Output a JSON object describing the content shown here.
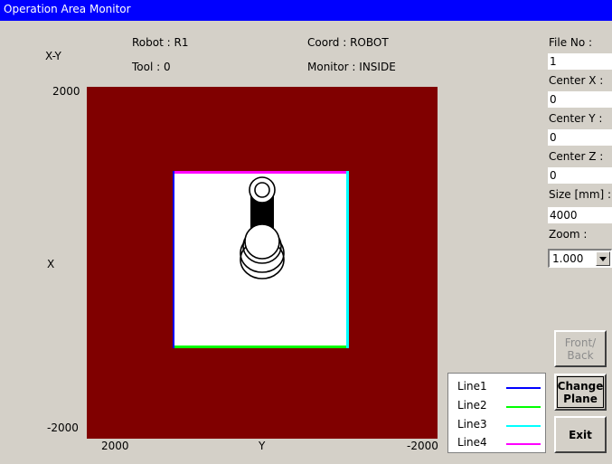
{
  "window": {
    "title": "Operation Area Monitor"
  },
  "header": {
    "plane_label": "X-Y",
    "robot": "Robot : R1",
    "tool": "Tool : 0",
    "coord": "Coord : ROBOT",
    "monitor": "Monitor : INSIDE"
  },
  "plot": {
    "y_max_label": "2000",
    "y_min_label": "-2000",
    "x_left_label": "2000",
    "x_right_label": "-2000",
    "vertical_axis_name": "X",
    "horizontal_axis_name": "Y",
    "outside_color": "#800000",
    "area_color": "#ffffff"
  },
  "side_panel": {
    "fields": [
      {
        "label": "File No :",
        "value": "1"
      },
      {
        "label": "Center X :",
        "value": "0"
      },
      {
        "label": "Center Y :",
        "value": "0"
      },
      {
        "label": "Center Z :",
        "value": "0"
      },
      {
        "label": "Size [mm] :",
        "value": "4000"
      }
    ],
    "zoom": {
      "label": "Zoom :",
      "value": "1.000"
    }
  },
  "legend": [
    {
      "label": "Line1",
      "color": "#0000ff"
    },
    {
      "label": "Line2",
      "color": "#00ff00"
    },
    {
      "label": "Line3",
      "color": "#00ffff"
    },
    {
      "label": "Line4",
      "color": "#ff00ff"
    }
  ],
  "buttons": {
    "front_back": "Front/\nBack",
    "change_plane": "Change\nPlane",
    "exit": "Exit"
  }
}
